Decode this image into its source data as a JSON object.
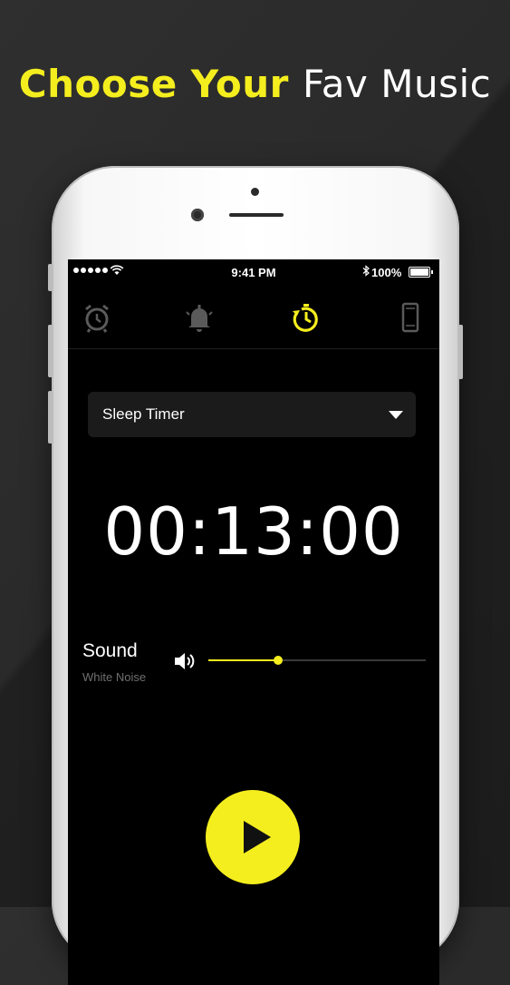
{
  "headline": {
    "part1": "Choose Your",
    "part2": "Fav Music"
  },
  "status_bar": {
    "time": "9:41 PM",
    "battery": "100%",
    "bluetooth_icon": "bluetooth-icon"
  },
  "tabs": [
    {
      "icon": "alarm-clock-icon",
      "active": false
    },
    {
      "icon": "bell-icon",
      "active": false
    },
    {
      "icon": "timer-icon",
      "active": true
    },
    {
      "icon": "phone-icon",
      "active": false
    }
  ],
  "dropdown": {
    "value": "Sleep Timer"
  },
  "timer": {
    "value": "00:13:00"
  },
  "sound": {
    "title": "Sound",
    "subtitle": "White Noise",
    "volume": 0.32
  },
  "colors": {
    "accent": "#f5ee1e",
    "background": "#000000",
    "inactive_icon": "#5a5a5a"
  }
}
